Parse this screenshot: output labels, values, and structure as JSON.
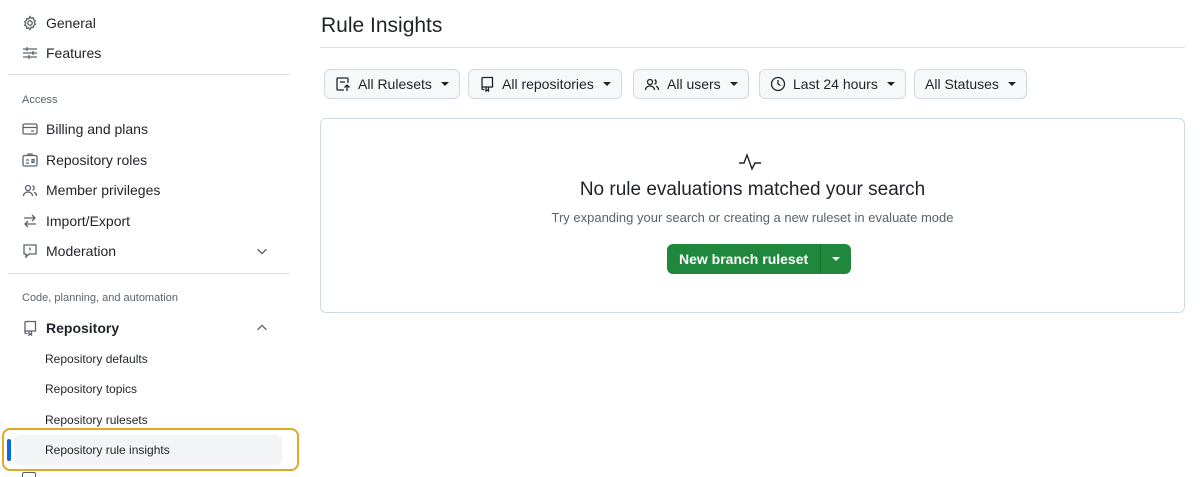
{
  "sidebar": {
    "items_top": [
      {
        "label": "General",
        "icon": "gear-icon"
      },
      {
        "label": "Features",
        "icon": "sliders-icon"
      }
    ],
    "access_label": "Access",
    "access_items": [
      {
        "label": "Billing and plans",
        "icon": "credit-card-icon"
      },
      {
        "label": "Repository roles",
        "icon": "id-badge-icon"
      },
      {
        "label": "Member privileges",
        "icon": "people-icon"
      },
      {
        "label": "Import/Export",
        "icon": "arrow-switch-icon"
      },
      {
        "label": "Moderation",
        "icon": "report-icon"
      }
    ],
    "code_label": "Code, planning, and automation",
    "repository_label": "Repository",
    "repository_subitems": [
      "Repository defaults",
      "Repository topics",
      "Repository rulesets",
      "Repository rule insights"
    ]
  },
  "main": {
    "title": "Rule Insights",
    "filters": [
      {
        "label": "All Rulesets",
        "icon": "ruleset-icon"
      },
      {
        "label": "All repositories",
        "icon": "repo-icon"
      },
      {
        "label": "All users",
        "icon": "people-icon"
      },
      {
        "label": "Last 24 hours",
        "icon": "clock-icon"
      },
      {
        "label": "All Statuses",
        "icon": ""
      }
    ],
    "blankslate": {
      "icon": "pulse-icon",
      "title": "No rule evaluations matched your search",
      "description": "Try expanding your search or creating a new ruleset in evaluate mode",
      "button_label": "New branch ruleset"
    }
  },
  "colors": {
    "accent": "#0969da",
    "primary_button": "#1f883d",
    "highlight_border": "#e2a62b"
  }
}
